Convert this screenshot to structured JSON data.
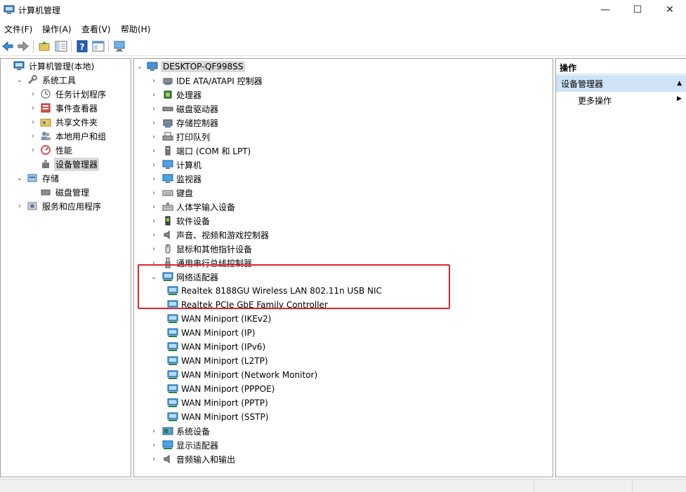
{
  "window": {
    "title": "计算机管理",
    "minimize": "—",
    "maximize": "☐",
    "close": "✕"
  },
  "menu": [
    "文件(F)",
    "操作(A)",
    "查看(V)",
    "帮助(H)"
  ],
  "left_tree": [
    {
      "label": "计算机管理(本地)",
      "indent": 0,
      "chevron": "",
      "icon": "computer-management-icon"
    },
    {
      "label": "系统工具",
      "indent": 1,
      "chevron": "down",
      "icon": "tools-icon"
    },
    {
      "label": "任务计划程序",
      "indent": 2,
      "chevron": "right",
      "icon": "clock-icon"
    },
    {
      "label": "事件查看器",
      "indent": 2,
      "chevron": "right",
      "icon": "event-viewer-icon"
    },
    {
      "label": "共享文件夹",
      "indent": 2,
      "chevron": "right",
      "icon": "shared-folder-icon"
    },
    {
      "label": "本地用户和组",
      "indent": 2,
      "chevron": "right",
      "icon": "users-icon"
    },
    {
      "label": "性能",
      "indent": 2,
      "chevron": "right",
      "icon": "performance-icon"
    },
    {
      "label": "设备管理器",
      "indent": 2,
      "chevron": "",
      "icon": "device-manager-icon",
      "selected": true
    },
    {
      "label": "存储",
      "indent": 1,
      "chevron": "down",
      "icon": "storage-icon"
    },
    {
      "label": "磁盘管理",
      "indent": 2,
      "chevron": "",
      "icon": "disk-management-icon"
    },
    {
      "label": "服务和应用程序",
      "indent": 1,
      "chevron": "right",
      "icon": "services-icon"
    }
  ],
  "device_tree": {
    "root": "DESKTOP-QF998SS",
    "items": [
      {
        "label": "IDE ATA/ATAPI 控制器",
        "indent": 1,
        "chevron": "right",
        "icon": "ide-controller-icon"
      },
      {
        "label": "处理器",
        "indent": 1,
        "chevron": "right",
        "icon": "processor-icon"
      },
      {
        "label": "磁盘驱动器",
        "indent": 1,
        "chevron": "right",
        "icon": "disk-drive-icon"
      },
      {
        "label": "存储控制器",
        "indent": 1,
        "chevron": "right",
        "icon": "storage-controller-icon"
      },
      {
        "label": "打印队列",
        "indent": 1,
        "chevron": "right",
        "icon": "printer-icon"
      },
      {
        "label": "端口 (COM 和 LPT)",
        "indent": 1,
        "chevron": "right",
        "icon": "port-icon"
      },
      {
        "label": "计算机",
        "indent": 1,
        "chevron": "right",
        "icon": "monitor-icon"
      },
      {
        "label": "监视器",
        "indent": 1,
        "chevron": "right",
        "icon": "monitor-icon"
      },
      {
        "label": "键盘",
        "indent": 1,
        "chevron": "right",
        "icon": "keyboard-icon"
      },
      {
        "label": "人体学输入设备",
        "indent": 1,
        "chevron": "right",
        "icon": "hid-icon"
      },
      {
        "label": "软件设备",
        "indent": 1,
        "chevron": "right",
        "icon": "software-device-icon"
      },
      {
        "label": "声音、视频和游戏控制器",
        "indent": 1,
        "chevron": "right",
        "icon": "speaker-icon"
      },
      {
        "label": "鼠标和其他指针设备",
        "indent": 1,
        "chevron": "right",
        "icon": "mouse-icon"
      },
      {
        "label": "通用串行总线控制器",
        "indent": 1,
        "chevron": "right",
        "icon": "usb-icon"
      },
      {
        "label": "网络适配器",
        "indent": 1,
        "chevron": "down",
        "icon": "network-adapter-icon"
      },
      {
        "label": "Realtek 8188GU Wireless LAN 802.11n USB NIC",
        "indent": 2,
        "chevron": "",
        "icon": "network-adapter-icon"
      },
      {
        "label": "Realtek PCIe GbE Family Controller",
        "indent": 2,
        "chevron": "",
        "icon": "network-adapter-icon"
      },
      {
        "label": "WAN Miniport (IKEv2)",
        "indent": 2,
        "chevron": "",
        "icon": "network-adapter-icon"
      },
      {
        "label": "WAN Miniport (IP)",
        "indent": 2,
        "chevron": "",
        "icon": "network-adapter-icon"
      },
      {
        "label": "WAN Miniport (IPv6)",
        "indent": 2,
        "chevron": "",
        "icon": "network-adapter-icon"
      },
      {
        "label": "WAN Miniport (L2TP)",
        "indent": 2,
        "chevron": "",
        "icon": "network-adapter-icon"
      },
      {
        "label": "WAN Miniport (Network Monitor)",
        "indent": 2,
        "chevron": "",
        "icon": "network-adapter-icon"
      },
      {
        "label": "WAN Miniport (PPPOE)",
        "indent": 2,
        "chevron": "",
        "icon": "network-adapter-icon"
      },
      {
        "label": "WAN Miniport (PPTP)",
        "indent": 2,
        "chevron": "",
        "icon": "network-adapter-icon"
      },
      {
        "label": "WAN Miniport (SSTP)",
        "indent": 2,
        "chevron": "",
        "icon": "network-adapter-icon"
      },
      {
        "label": "系统设备",
        "indent": 1,
        "chevron": "right",
        "icon": "system-device-icon"
      },
      {
        "label": "显示适配器",
        "indent": 1,
        "chevron": "right",
        "icon": "display-adapter-icon"
      },
      {
        "label": "音频输入和输出",
        "indent": 1,
        "chevron": "right",
        "icon": "speaker-icon"
      }
    ]
  },
  "actions": {
    "header": "操作",
    "section": "设备管理器",
    "more": "更多操作"
  },
  "colors": {
    "accent": "#cfe3f6",
    "highlight_box": "#e1232b",
    "selected": "#d9d9d9"
  }
}
